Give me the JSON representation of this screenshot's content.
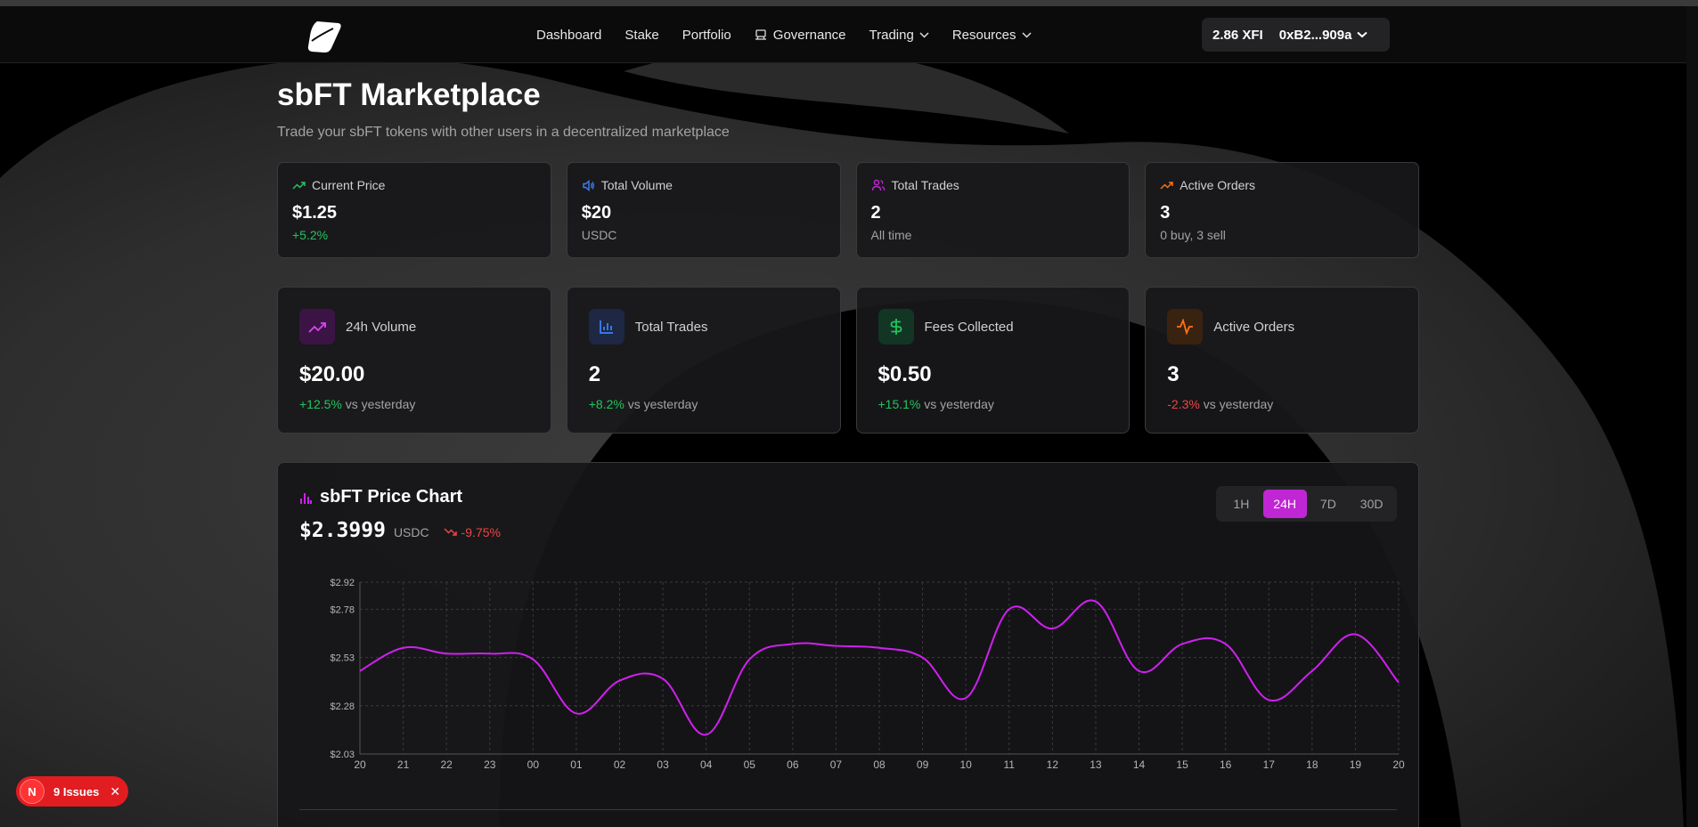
{
  "nav": {
    "items": [
      {
        "label": "Dashboard"
      },
      {
        "label": "Stake"
      },
      {
        "label": "Portfolio"
      },
      {
        "label": "Governance",
        "icon": "governance-icon"
      },
      {
        "label": "Trading",
        "dropdown": true
      },
      {
        "label": "Resources",
        "dropdown": true
      }
    ]
  },
  "wallet": {
    "balance": "2.86 XFI",
    "address": "0xB2...909a"
  },
  "page": {
    "title": "sbFT Marketplace",
    "subtitle": "Trade your sbFT tokens with other users in a decentralized marketplace"
  },
  "stats": [
    {
      "label": "Current Price",
      "value": "$1.25",
      "sub": "+5.2%",
      "icon": "trending-up-icon",
      "color": "#22c55e"
    },
    {
      "label": "Total Volume",
      "value": "$20",
      "sub": "USDC",
      "icon": "volume-icon",
      "color": "#3b82f6"
    },
    {
      "label": "Total Trades",
      "value": "2",
      "sub": "All time",
      "icon": "users-icon",
      "color": "#c026d3"
    },
    {
      "label": "Active Orders",
      "value": "3",
      "sub": "0 buy, 3 sell",
      "icon": "trending-up-icon",
      "color": "#f97316"
    }
  ],
  "stats2": [
    {
      "label": "24h Volume",
      "value": "$20.00",
      "change": "+12.5%",
      "suffix": "vs yesterday",
      "icon": "trending-up-icon"
    },
    {
      "label": "Total Trades",
      "value": "2",
      "change": "+8.2%",
      "suffix": "vs yesterday",
      "icon": "bar-chart-icon"
    },
    {
      "label": "Fees Collected",
      "value": "$0.50",
      "change": "+15.1%",
      "suffix": "vs yesterday",
      "icon": "dollar-icon"
    },
    {
      "label": "Active Orders",
      "value": "3",
      "change": "-2.3%",
      "suffix": "vs yesterday",
      "icon": "activity-icon"
    }
  ],
  "chart_header": {
    "title": "sbFT Price Chart",
    "price": "$2.3999",
    "unit": "USDC",
    "change": "-9.75%",
    "timeframes": [
      "1H",
      "24H",
      "7D",
      "30D"
    ],
    "active_timeframe": "24H"
  },
  "chart_data": {
    "type": "line",
    "title": "sbFT Price Chart",
    "x": [
      "20",
      "21",
      "22",
      "23",
      "00",
      "01",
      "02",
      "03",
      "04",
      "05",
      "06",
      "07",
      "08",
      "09",
      "10",
      "11",
      "12",
      "13",
      "14",
      "15",
      "16",
      "17",
      "18",
      "19",
      "20"
    ],
    "y_tick_labels": [
      "$2.03",
      "$2.28",
      "$2.53",
      "$2.78",
      "$2.92"
    ],
    "ylim": [
      2.03,
      2.92
    ],
    "grid": true,
    "series": [
      {
        "values": [
          2.46,
          2.58,
          2.55,
          2.55,
          2.52,
          2.24,
          2.41,
          2.42,
          2.13,
          2.52,
          2.6,
          2.59,
          2.58,
          2.53,
          2.32,
          2.78,
          2.68,
          2.82,
          2.46,
          2.6,
          2.6,
          2.31,
          2.46,
          2.65,
          2.4
        ],
        "color": "#d020f0"
      }
    ]
  },
  "issues_badge": {
    "letter": "N",
    "label": "9 Issues"
  }
}
